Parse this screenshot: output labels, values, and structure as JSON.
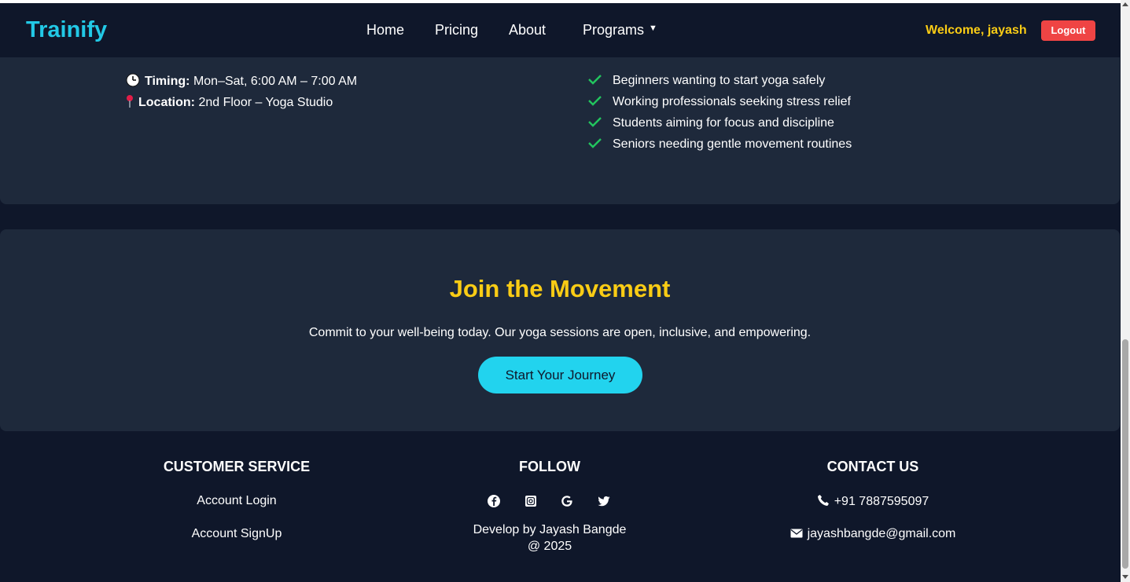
{
  "navbar": {
    "brand": "Trainify",
    "links": [
      "Home",
      "Pricing",
      "About",
      "Programs"
    ],
    "welcome": "Welcome, jayash",
    "logout": "Logout"
  },
  "details": {
    "timing_label": "Timing:",
    "timing_value": "Mon–Sat, 6:00 AM – 7:00 AM",
    "location_label": "Location:",
    "location_value": "2nd Floor – Yoga Studio",
    "audience": [
      "Beginners wanting to start yoga safely",
      "Working professionals seeking stress relief",
      "Students aiming for focus and discipline",
      "Seniors needing gentle movement routines"
    ]
  },
  "cta": {
    "title": "Join the Movement",
    "text": "Commit to your well-being today. Our yoga sessions are open, inclusive, and empowering.",
    "button": "Start Your Journey"
  },
  "footer": {
    "customer_service": {
      "heading": "CUSTOMER SERVICE",
      "links": [
        "Account Login",
        "Account SignUp"
      ]
    },
    "follow": {
      "heading": "FOLLOW",
      "icons": [
        "facebook-icon",
        "instagram-icon",
        "google-icon",
        "twitter-icon"
      ],
      "credit_line1": "Develop by Jayash Bangde",
      "credit_line2": "@ 2025"
    },
    "contact": {
      "heading": "CONTACT US",
      "phone": "+91 7887595097",
      "email": "jayashbangde@gmail.com"
    }
  },
  "colors": {
    "background": "#0f172a",
    "card": "#1e293b",
    "brand": "#22c9e6",
    "accent_yellow": "#facc15",
    "logout_red": "#ef4444",
    "cta_cyan": "#22d3ee",
    "check_green": "#22c55e"
  }
}
